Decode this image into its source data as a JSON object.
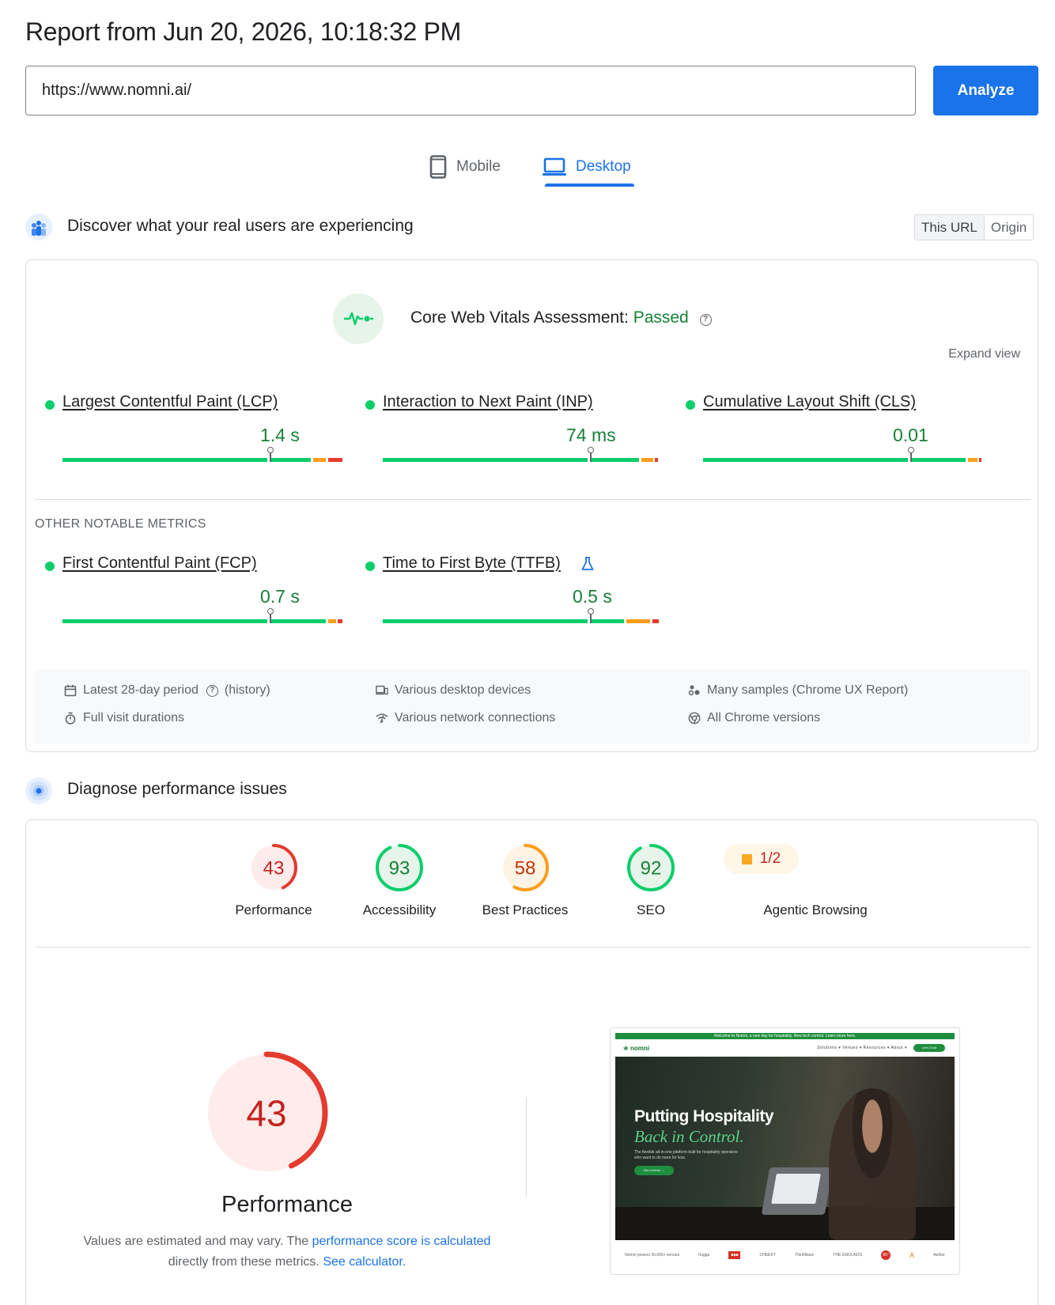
{
  "header": {
    "report_title": "Report from Jun 20, 2026, 10:18:32 PM",
    "url_value": "https://www.nomni.ai/",
    "analyze_label": "Analyze"
  },
  "tabs": {
    "mobile": "Mobile",
    "desktop": "Desktop",
    "active": "desktop"
  },
  "crux": {
    "section_title": "Discover what your real users are experiencing",
    "toggle": [
      "This URL",
      "Origin"
    ],
    "toggle_active": "This URL",
    "assessment_label": "Core Web Vitals Assessment:",
    "assessment_status": "Passed",
    "expand_label": "Expand view",
    "core_metrics": [
      {
        "label": "Largest Contentful Paint (LCP)",
        "value": "1.4 s",
        "status": "good"
      },
      {
        "label": "Interaction to Next Paint (INP)",
        "value": "74 ms",
        "status": "good"
      },
      {
        "label": "Cumulative Layout Shift (CLS)",
        "value": "0.01",
        "status": "good"
      }
    ],
    "other_title": "OTHER NOTABLE METRICS",
    "other_metrics": [
      {
        "label": "First Contentful Paint (FCP)",
        "value": "0.7 s",
        "status": "good"
      },
      {
        "label": "Time to First Byte (TTFB)",
        "value": "0.5 s",
        "status": "good",
        "experimental": true
      }
    ],
    "footer": {
      "period": "Latest 28-day period",
      "history": "history",
      "durations": "Full visit durations",
      "devices": "Various desktop devices",
      "network": "Various network connections",
      "samples_prefix": "Many samples (",
      "samples_link": "Chrome UX Report",
      "samples_suffix": ")",
      "versions": "All Chrome versions"
    }
  },
  "lighthouse": {
    "section_title": "Diagnose performance issues",
    "scores": [
      {
        "label": "Performance",
        "score": 43,
        "color": "#e33b2e",
        "bg": "#fdeceb"
      },
      {
        "label": "Accessibility",
        "score": 93,
        "color": "#0cce6b",
        "bg": "#e6f4ea"
      },
      {
        "label": "Best Practices",
        "score": 58,
        "color": "#fa9d1a",
        "bg": "#fef4e6"
      },
      {
        "label": "SEO",
        "score": 92,
        "color": "#0cce6b",
        "bg": "#e6f4ea"
      }
    ],
    "agentic": {
      "label": "Agentic Browsing",
      "value": "1/2"
    },
    "main_score": 43,
    "main_label": "Performance",
    "note_text_1": "Values are estimated and may vary. The ",
    "note_link_1": "performance score is calculated",
    "note_text_2": " directly from these metrics. ",
    "note_link_2": "See calculator."
  },
  "screenshot": {
    "banner": "Welcome to Nomni, a new day for hospitality. New tech control. Learn more here.",
    "logo": "nomni",
    "menu": "Solutions ▾   Venues ▾   Resources ▾   About ▾",
    "cta": "Let's Chat",
    "headline": "Putting Hospitality",
    "headline_accent": "Back in Control.",
    "subtext": "The flexible all-in-one platform built for hospitality operators who want to do more for less.",
    "button": "Get a Demo →",
    "logos": [
      "Nomni powers 30,000+ venues",
      "hugga",
      "■■■",
      "CHEEKY",
      "ThirdWave",
      "THE GROUNDS",
      "85°",
      "A",
      "Aether"
    ]
  },
  "colors": {
    "accent": "#1a73e8",
    "good": "#0cce6b",
    "good_text": "#188038",
    "average": "#fa9d1a",
    "poor": "#e33b2e"
  }
}
